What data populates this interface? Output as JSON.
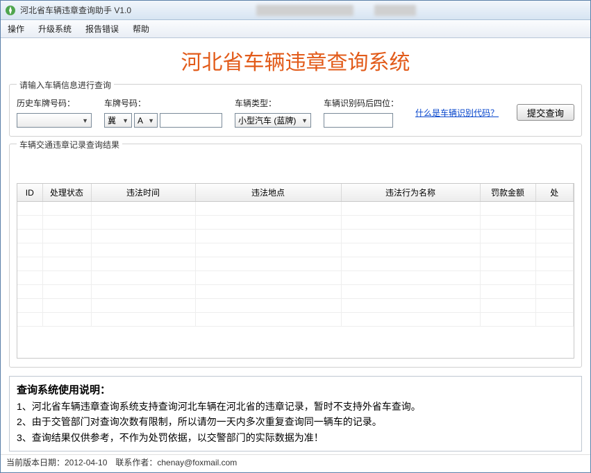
{
  "window": {
    "title": "河北省车辆违章查询助手 V1.0"
  },
  "menu": {
    "operate": "操作",
    "upgrade": "升级系统",
    "report": "报告错误",
    "help": "帮助"
  },
  "main_title": "河北省车辆违章查询系统",
  "input_group": {
    "label": "请输入车辆信息进行查询",
    "history_label": "历史车牌号码：",
    "plate_label": "车牌号码：",
    "plate_province": "冀",
    "plate_letter": "A",
    "type_label": "车辆类型：",
    "type_value": "小型汽车 (蓝牌)",
    "vin_label": "车辆识别码后四位：",
    "vin_link": "什么是车辆识别代码？",
    "submit": "提交查询"
  },
  "results_group": {
    "label": "车辆交通违章记录查询结果"
  },
  "columns": {
    "id": "ID",
    "status": "处理状态",
    "time": "违法时间",
    "location": "违法地点",
    "behavior": "违法行为名称",
    "fine": "罚款金额",
    "proc": "处"
  },
  "instructions": {
    "heading": "查询系统使用说明：",
    "line1": "1、河北省车辆违章查询系统支持查询河北车辆在河北省的违章记录，暂时不支持外省车查询。",
    "line2": "2、由于交管部门对查询次数有限制，所以请勿一天内多次重复查询同一辆车的记录。",
    "line3": "3、查询结果仅供参考，不作为处罚依据，以交警部门的实际数据为准！"
  },
  "footer": "当前版本日期：2012-04-10　联系作者：chenay@foxmail.com"
}
